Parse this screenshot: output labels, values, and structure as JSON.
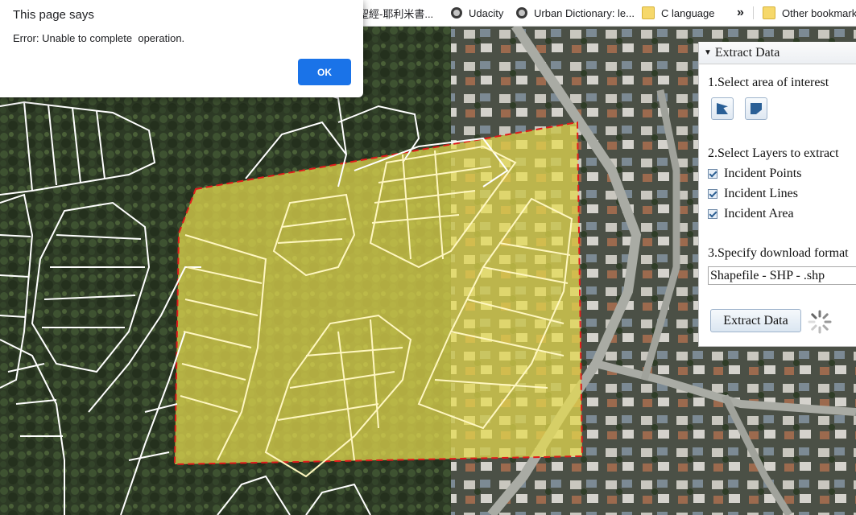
{
  "bookmarks": {
    "items": [
      {
        "label": "聖經-耶利米書...",
        "icon": "bible-icon"
      },
      {
        "label": "Udacity",
        "icon": "udacity-icon"
      },
      {
        "label": "Urban Dictionary: le...",
        "icon": "urban-dictionary-icon"
      },
      {
        "label": "C language",
        "icon": "folder-icon"
      }
    ],
    "more": "»",
    "other": "Other bookmarks"
  },
  "alert": {
    "title": "This page says",
    "message": "Error: Unable to complete  operation.",
    "ok_label": "OK"
  },
  "panel": {
    "title": "Extract Data",
    "step1": "1.Select area of interest",
    "step2": "2.Select Layers to extract",
    "layers": [
      {
        "label": "Incident Points",
        "checked": true
      },
      {
        "label": "Incident Lines",
        "checked": true
      },
      {
        "label": "Incident Area",
        "checked": true
      }
    ],
    "step3": "3.Specify download format",
    "format": "Shapefile - SHP - .shp",
    "extract_label": "Extract Data"
  },
  "colors": {
    "accent": "#1a73e8",
    "selection_fill": "#f2ea6a",
    "selection_border": "#e01b1b",
    "parcel_line": "#ffffff"
  }
}
